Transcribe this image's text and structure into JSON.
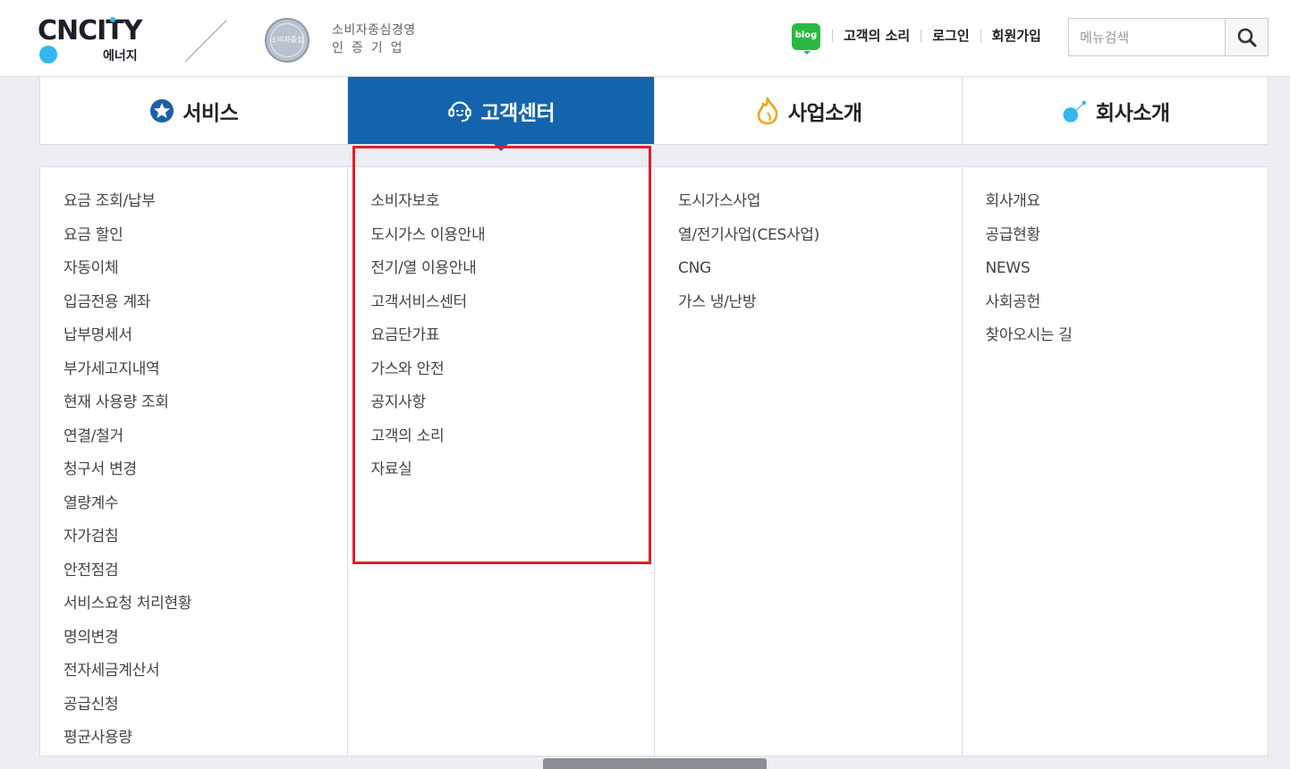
{
  "header": {
    "logo_text": "CNCITY",
    "logo_sub": "에너지",
    "badge_text": "소비자중심",
    "cert_line1": "소비자중심경영",
    "cert_line2": "인증기업",
    "blog_label": "blog",
    "links": [
      "고객의 소리",
      "로그인",
      "회원가입"
    ],
    "search_placeholder": "메뉴검색"
  },
  "nav": {
    "tabs": [
      {
        "label": "서비스",
        "icon": "star-badge-icon",
        "active": false
      },
      {
        "label": "고객센터",
        "icon": "headset-icon",
        "active": true
      },
      {
        "label": "사업소개",
        "icon": "flame-icon",
        "active": false
      },
      {
        "label": "회사소개",
        "icon": "dot-icon",
        "active": false
      }
    ]
  },
  "menu": {
    "service": [
      "요금 조회/납부",
      "요금 할인",
      "자동이체",
      "입금전용 계좌",
      "납부명세서",
      "부가세고지내역",
      "현재 사용량 조회",
      "연결/철거",
      "청구서 변경",
      "열량계수",
      "자가검침",
      "안전점검",
      "서비스요청 처리현황",
      "명의변경",
      "전자세금계산서",
      "공급신청",
      "평균사용량"
    ],
    "customer": [
      "소비자보호",
      "도시가스 이용안내",
      "전기/열 이용안내",
      "고객서비스센터",
      "요금단가표",
      "가스와 안전",
      "공지사항",
      "고객의 소리",
      "자료실"
    ],
    "business": [
      "도시가스사업",
      "열/전기사업(CES사업)",
      "CNG",
      "가스 냉/난방"
    ],
    "company": [
      "회사개요",
      "공급현황",
      "NEWS",
      "사회공헌",
      "찾아오시는 길"
    ]
  },
  "colors": {
    "active_tab": "#1464ad",
    "highlight": "#e11e28",
    "brand_dot": "#33b7ee",
    "blog_green": "#2bb842"
  }
}
